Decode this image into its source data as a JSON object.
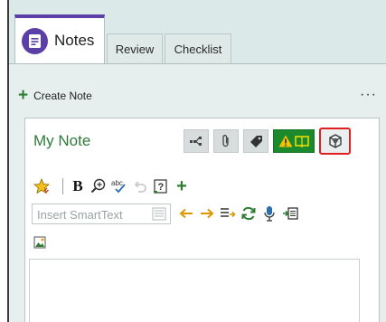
{
  "tabs": {
    "notes": "Notes",
    "review": "Review",
    "checklist": "Checklist"
  },
  "actions": {
    "create_note": "Create Note",
    "more": "···"
  },
  "note": {
    "title": "My Note",
    "smarttext_placeholder": "Insert SmartText"
  },
  "colors": {
    "accent_purple": "#5b3fa6",
    "title_green": "#2f7a3b",
    "plus_green": "#2e7d32",
    "button_green": "#1a8a2d",
    "highlight_red": "#e0201e"
  }
}
